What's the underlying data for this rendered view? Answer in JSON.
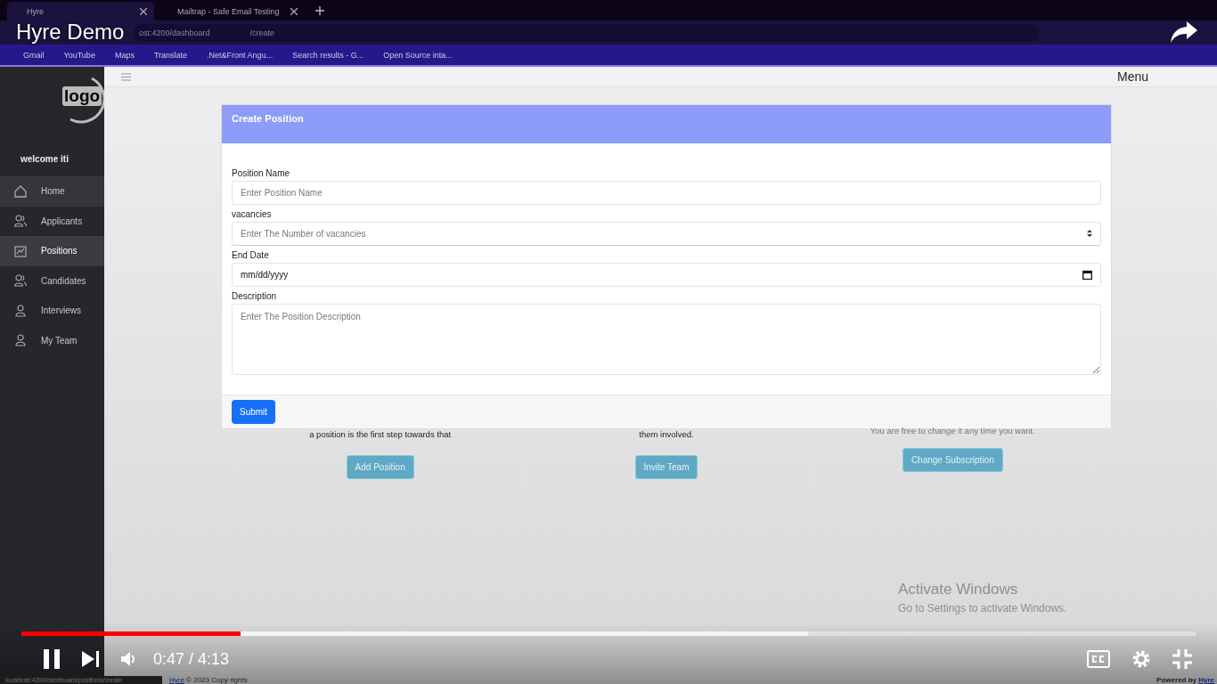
{
  "browser": {
    "tabs": [
      {
        "label": "Hyre",
        "selected": true
      },
      {
        "label": "Mailtrap - Safe Email Testing",
        "selected": false
      }
    ],
    "address": [
      "ost:4200/dashboard",
      "/create"
    ],
    "bookmarks": [
      "Gmail",
      "YouTube",
      "Maps",
      "Translate",
      ".Net&Front Angu...",
      "Search results - G...",
      "Open Source inta..."
    ]
  },
  "sidebar": {
    "logo": "logo",
    "welcome": "welcome iti",
    "items": [
      {
        "label": "Home",
        "kind": "home",
        "selected": false,
        "hovered": true
      },
      {
        "label": "Applicants",
        "kind": "group",
        "selected": false,
        "hovered": false
      },
      {
        "label": "Positions",
        "kind": "chart",
        "selected": true,
        "hovered": false
      },
      {
        "label": "Candidates",
        "kind": "group",
        "selected": false,
        "hovered": false
      },
      {
        "label": "Interviews",
        "kind": "person",
        "selected": false,
        "hovered": false
      },
      {
        "label": "My Team",
        "kind": "person",
        "selected": false,
        "hovered": false
      }
    ]
  },
  "header": {
    "menu": "Menu"
  },
  "form": {
    "title": "Create Position",
    "fields": [
      {
        "kind": "text",
        "label": "Position Name",
        "placeholder": "Enter Position Name"
      },
      {
        "kind": "number",
        "label": "vacancies",
        "placeholder": "Enter The Number of vacancies"
      },
      {
        "kind": "date",
        "label": "End Date",
        "value": "mm/dd/yyyy"
      },
      {
        "kind": "textarea",
        "label": "Description",
        "placeholder": "Enter The Position Description"
      }
    ],
    "submit": "Submit"
  },
  "cards": [
    {
      "text": "a position is the first step towards that",
      "button": "Add Position"
    },
    {
      "text": "them involved.",
      "button": "Invite Team"
    },
    {
      "text": "You are free to change it any time you want.",
      "button": "Change Subscription"
    }
  ],
  "activation": {
    "title": "Activate Windows",
    "subtitle": "Go to Settings to activate Windows."
  },
  "footer": {
    "link": "Hyre",
    "text": "© 2023 Copy rights",
    "powered": "Powered by",
    "powered_link": "Hyre",
    "status_url": "localhost:4200/dashboard/positions/create"
  },
  "video": {
    "title": "Hyre Demo",
    "time": "0:47 / 4:13",
    "level": 0.187
  }
}
